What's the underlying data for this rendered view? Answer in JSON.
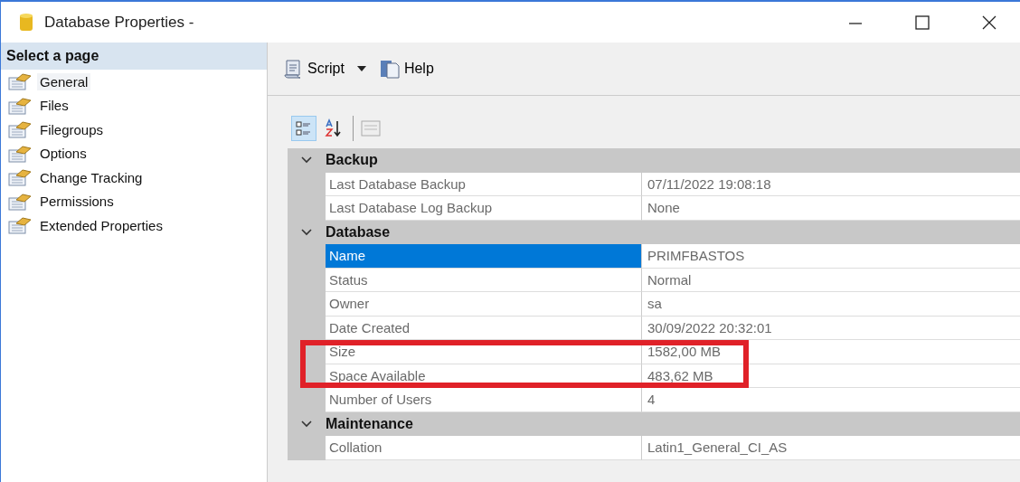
{
  "window": {
    "title": "Database Properties -"
  },
  "sidebar": {
    "heading": "Select a page",
    "items": [
      {
        "label": "General",
        "selected": true
      },
      {
        "label": "Files",
        "selected": false
      },
      {
        "label": "Filegroups",
        "selected": false
      },
      {
        "label": "Options",
        "selected": false
      },
      {
        "label": "Change Tracking",
        "selected": false
      },
      {
        "label": "Permissions",
        "selected": false
      },
      {
        "label": "Extended Properties",
        "selected": false
      }
    ]
  },
  "toolbar": {
    "script": "Script",
    "help": "Help"
  },
  "grid_toolbar": {
    "categorized_selected": true,
    "alphabetical_selected": false
  },
  "categories": [
    {
      "name": "Backup",
      "expanded": true,
      "rows": [
        {
          "name": "Last Database Backup",
          "value": "07/11/2022 19:08:18",
          "selected": false,
          "highlighted": false
        },
        {
          "name": "Last Database Log Backup",
          "value": "None",
          "selected": false,
          "highlighted": false
        }
      ]
    },
    {
      "name": "Database",
      "expanded": true,
      "rows": [
        {
          "name": "Name",
          "value": "PRIMFBASTOS",
          "selected": true,
          "highlighted": false
        },
        {
          "name": "Status",
          "value": "Normal",
          "selected": false,
          "highlighted": false
        },
        {
          "name": "Owner",
          "value": "sa",
          "selected": false,
          "highlighted": false
        },
        {
          "name": "Date Created",
          "value": "30/09/2022 20:32:01",
          "selected": false,
          "highlighted": false
        },
        {
          "name": "Size",
          "value": "1582,00 MB",
          "selected": false,
          "highlighted": true
        },
        {
          "name": "Space Available",
          "value": "483,62 MB",
          "selected": false,
          "highlighted": true
        },
        {
          "name": "Number of Users",
          "value": "4",
          "selected": false,
          "highlighted": false
        }
      ]
    },
    {
      "name": "Maintenance",
      "expanded": true,
      "rows": [
        {
          "name": "Collation",
          "value": "Latin1_General_CI_AS",
          "selected": false,
          "highlighted": false
        }
      ]
    }
  ]
}
